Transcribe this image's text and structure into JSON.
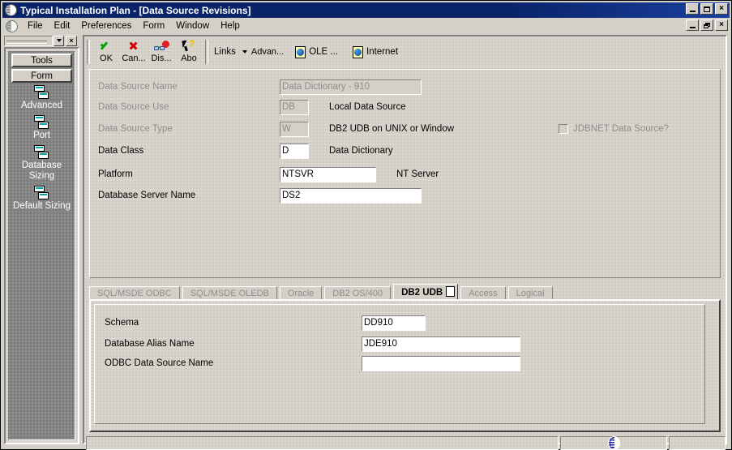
{
  "window": {
    "title": "Typical Installation Plan  - [Data Source Revisions]",
    "app_icon": "globe-icon",
    "controls": {
      "minimize": "_",
      "maximize": "□",
      "close": "×"
    },
    "mdi_controls": {
      "minimize": "_",
      "restore": "❐",
      "close": "×"
    }
  },
  "menubar": {
    "items": [
      {
        "label": "File"
      },
      {
        "label": "Edit"
      },
      {
        "label": "Preferences"
      },
      {
        "label": "Form"
      },
      {
        "label": "Window"
      },
      {
        "label": "Help"
      }
    ]
  },
  "sidebar": {
    "combo_value": "",
    "close_label": "×",
    "tabs": [
      {
        "label": "Tools"
      },
      {
        "label": "Form"
      }
    ],
    "items": [
      {
        "label": "Advanced",
        "icon": "pages-icon"
      },
      {
        "label": "Port",
        "icon": "pages-icon"
      },
      {
        "label": "Database Sizing",
        "icon": "pages-icon"
      },
      {
        "label": "Default Sizing",
        "icon": "pages-icon"
      }
    ]
  },
  "toolbar": {
    "buttons": [
      {
        "label": "OK",
        "icon": "green-check-icon"
      },
      {
        "label": "Can...",
        "icon": "red-x-icon"
      },
      {
        "label": "Dis...",
        "icon": "glasses-icon"
      },
      {
        "label": "Abo",
        "icon": "arrow-question-icon"
      }
    ],
    "links_label": "Links",
    "links": [
      {
        "label": "Advan...",
        "icon": "chevron-down-icon"
      },
      {
        "label": "OLE ...",
        "icon": "document-icon"
      },
      {
        "label": "Internet",
        "icon": "document-icon"
      }
    ]
  },
  "form": {
    "fields": [
      {
        "label": "Data Source Name",
        "value": "Data Dictionary - 910",
        "side": "",
        "disabled": true
      },
      {
        "label": "Data Source Use",
        "value": "DB",
        "side": "Local Data Source",
        "disabled": true
      },
      {
        "label": "Data Source Type",
        "value": "W",
        "side": "DB2 UDB on UNIX or Window",
        "disabled": true
      },
      {
        "label": "Data Class",
        "value": "D",
        "side": "Data Dictionary",
        "disabled": false
      },
      {
        "label": "Platform",
        "value": "NTSVR",
        "side": "NT Server",
        "disabled": false
      },
      {
        "label": "Database Server Name",
        "value": "DS2",
        "side": "",
        "disabled": false
      }
    ],
    "checkbox": {
      "label": "JDBNET Data Source?",
      "checked": false,
      "disabled": true
    }
  },
  "tabs": {
    "items": [
      {
        "label": "SQL/MSDE ODBC",
        "active": false
      },
      {
        "label": "SQL/MSDE OLEDB",
        "active": false
      },
      {
        "label": "Oracle",
        "active": false
      },
      {
        "label": "DB2 OS/400",
        "active": false
      },
      {
        "label": "DB2 UDB",
        "active": true
      },
      {
        "label": "Access",
        "active": false
      },
      {
        "label": "Logical",
        "active": false
      }
    ]
  },
  "tabpanel": {
    "fields": [
      {
        "label": "Schema",
        "value": "DD910"
      },
      {
        "label": "Database Alias Name",
        "value": "JDE910"
      },
      {
        "label": "ODBC Data Source Name",
        "value": ""
      }
    ]
  },
  "statusbar": {
    "left_text": "",
    "middle_text": "",
    "right_text": "",
    "icon": "globe-icon"
  }
}
